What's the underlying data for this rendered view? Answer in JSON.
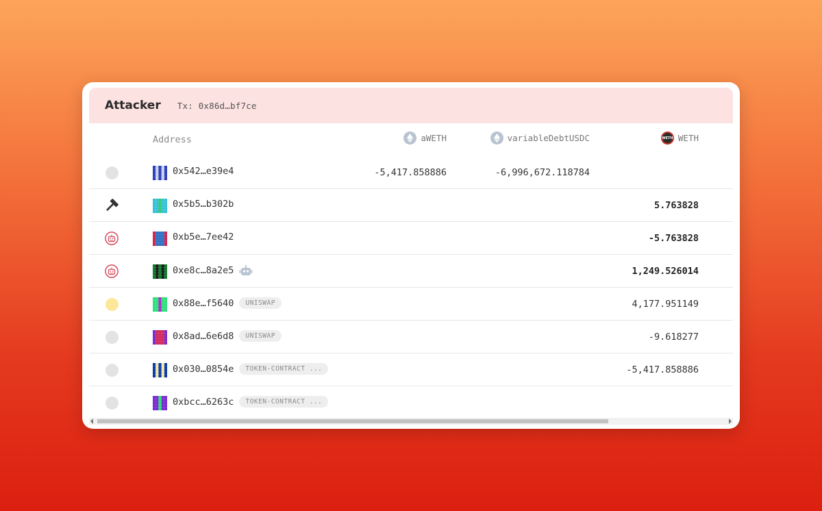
{
  "header": {
    "title": "Attacker",
    "tx": "Tx: 0x86d…bf7ce"
  },
  "columns": {
    "address": "Address",
    "tokens": [
      {
        "label": "aWETH",
        "icon": "ethereum-icon"
      },
      {
        "label": "variableDebtUSDC",
        "icon": "ethereum-icon"
      },
      {
        "label": "WETH",
        "icon": "weth-icon",
        "icon_text": "WETH"
      }
    ]
  },
  "rows": [
    {
      "status": "gray-dot",
      "address": "0x542…e39e4",
      "tag": "",
      "robot": false,
      "aweth": "-5,417.858886",
      "debt": "-6,996,672.118784",
      "weth": "",
      "weth_bold": false
    },
    {
      "status": "hammer-icon",
      "address": "0x5b5…b302b",
      "tag": "",
      "robot": false,
      "aweth": "",
      "debt": "",
      "weth": "5.763828",
      "weth_bold": true
    },
    {
      "status": "robot-icon",
      "address": "0xb5e…7ee42",
      "tag": "",
      "robot": false,
      "aweth": "",
      "debt": "",
      "weth": "-5.763828",
      "weth_bold": true
    },
    {
      "status": "robot-icon",
      "address": "0xe8c…8a2e5",
      "tag": "",
      "robot": true,
      "aweth": "",
      "debt": "",
      "weth": "1,249.526014",
      "weth_bold": true
    },
    {
      "status": "yellow-dot",
      "address": "0x88e…f5640",
      "tag": "UNISWAP",
      "robot": false,
      "aweth": "",
      "debt": "",
      "weth": "4,177.951149",
      "weth_bold": false
    },
    {
      "status": "gray-dot",
      "address": "0x8ad…6e6d8",
      "tag": "UNISWAP",
      "robot": false,
      "aweth": "",
      "debt": "",
      "weth": "-9.618277",
      "weth_bold": false
    },
    {
      "status": "gray-dot",
      "address": "0x030…0854e",
      "tag": "TOKEN-CONTRACT ...",
      "robot": false,
      "aweth": "",
      "debt": "",
      "weth": "-5,417.858886",
      "weth_bold": false
    },
    {
      "status": "gray-dot",
      "address": "0xbcc…6263c",
      "tag": "TOKEN-CONTRACT ...",
      "robot": false,
      "aweth": "",
      "debt": "",
      "weth": "",
      "weth_bold": false
    }
  ],
  "colors": {
    "header_bg": "#fde2e2",
    "robot_red": "#d6475b",
    "identicons": [
      [
        "#2a3fb5",
        "#c9d0f0"
      ],
      [
        "#36c0d8",
        "#2ecc71"
      ],
      [
        "#2f6fc4",
        "#d0234e"
      ],
      [
        "#0d7d2a",
        "#1a1a1a"
      ],
      [
        "#2ee07a",
        "#b02ad0"
      ],
      [
        "#d02a5e",
        "#7a2ad0"
      ],
      [
        "#0a3aa8",
        "#f2e6a8"
      ],
      [
        "#7a2ad0",
        "#2ee07a"
      ]
    ]
  }
}
